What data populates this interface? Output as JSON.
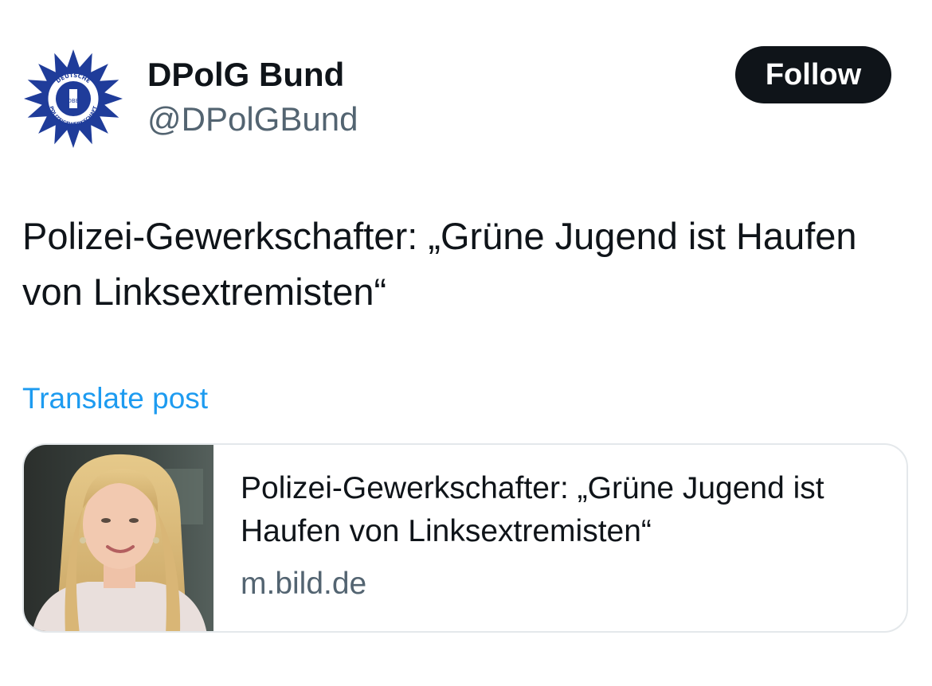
{
  "author": {
    "display_name": "DPolG Bund",
    "handle": "@DPolGBund",
    "avatar": {
      "icon": "police-union-star-badge-icon",
      "ring_text_top": "DEUTSCHE",
      "ring_text_bottom": "POLIZEIGEWERKSCHAFT",
      "center_text": "DBB",
      "color": "#1f3c9a"
    }
  },
  "follow_button": {
    "label": "Follow"
  },
  "post": {
    "text": "Polizei-Gewerkschafter: „Grüne Jugend ist Haufen von Linksextremisten“",
    "translate_label": "Translate post"
  },
  "link_card": {
    "title": "Polizei-Gewerkschafter: „Grüne Jugend ist Haufen von Linksextremisten“",
    "domain": "m.bild.de",
    "thumbnail": "portrait-photo"
  },
  "colors": {
    "text_primary": "#0f1419",
    "text_secondary": "#536471",
    "link_blue": "#1d9bf0",
    "button_bg": "#0f1419"
  }
}
